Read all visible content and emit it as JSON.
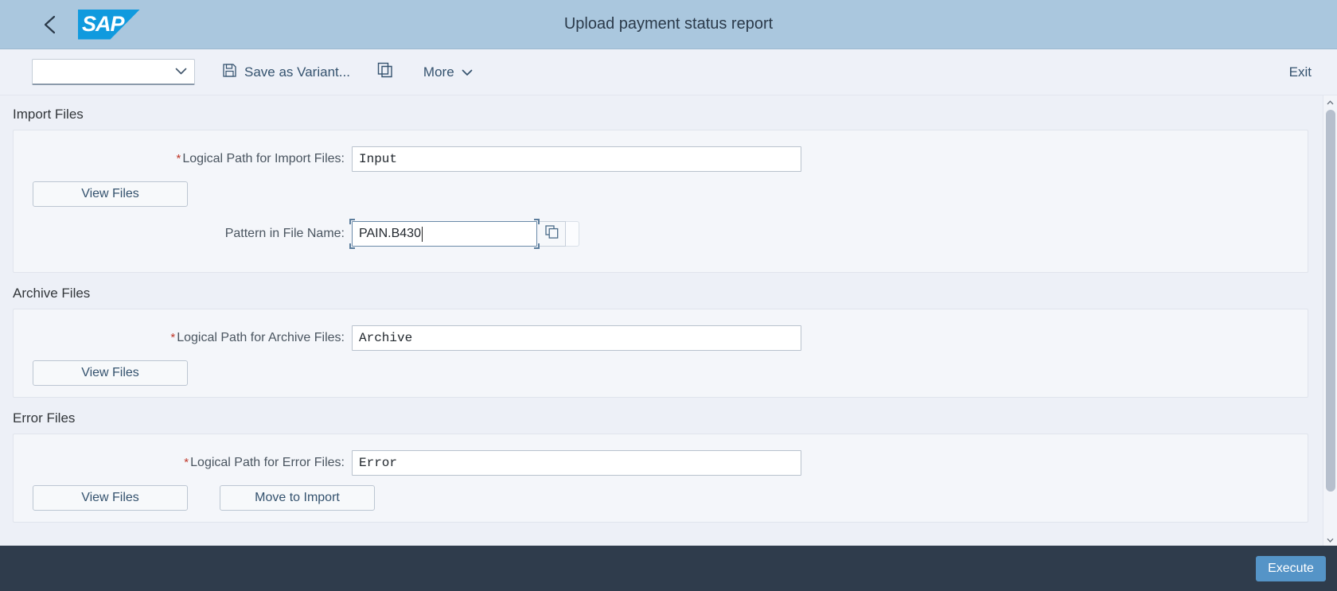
{
  "shell": {
    "title": "Upload payment status report",
    "back_icon": "chevron-left-icon",
    "logo_text": "SAP"
  },
  "toolbar": {
    "variant_value": "",
    "variant_placeholder": "",
    "save_variant_label": "Save as Variant...",
    "save_icon": "floppy-disk-icon",
    "copy_icon": "copy-icon",
    "more_label": "More",
    "more_icon": "chevron-down-icon",
    "exit_label": "Exit"
  },
  "sections": [
    {
      "title": "Import Files",
      "fields": [
        {
          "required": true,
          "label": "Logical Path for Import Files:",
          "value": "Input",
          "focused": false,
          "value_help": false
        },
        {
          "required": false,
          "label": "Pattern in File Name:",
          "value": "PAIN.B430",
          "focused": true,
          "value_help": true,
          "value_help_icon": "multi-select-icon"
        }
      ],
      "buttons": [
        {
          "label": "View Files"
        }
      ]
    },
    {
      "title": "Archive Files",
      "fields": [
        {
          "required": true,
          "label": "Logical Path for Archive Files:",
          "value": "Archive",
          "focused": false,
          "value_help": false
        }
      ],
      "buttons": [
        {
          "label": "View Files"
        }
      ]
    },
    {
      "title": "Error Files",
      "fields": [
        {
          "required": true,
          "label": "Logical Path for Error Files:",
          "value": "Error",
          "focused": false,
          "value_help": false
        }
      ],
      "buttons": [
        {
          "label": "View Files"
        },
        {
          "label": "Move to Import"
        }
      ]
    }
  ],
  "scrollbar": {
    "up_icon": "caret-up-icon",
    "down_icon": "caret-down-icon"
  },
  "footer": {
    "execute_label": "Execute"
  },
  "colors": {
    "shell_header_bg": "#aac7de",
    "sap_brand": "#109ade",
    "footer_bg": "#2f3c4c",
    "accent_button": "#5594c7",
    "required_star": "#c0392b",
    "link_text": "#34526e"
  }
}
